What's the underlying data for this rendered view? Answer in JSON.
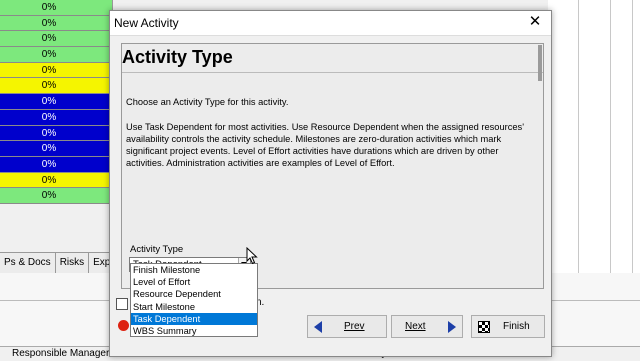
{
  "background": {
    "grid_rows": [
      {
        "text": "0%",
        "color": "green"
      },
      {
        "text": "0%",
        "color": "green"
      },
      {
        "text": "0%",
        "color": "green"
      },
      {
        "text": "0%",
        "color": "green"
      },
      {
        "text": "0%",
        "color": "yellow"
      },
      {
        "text": "0%",
        "color": "yellow"
      },
      {
        "text": "0%",
        "color": "blue"
      },
      {
        "text": "0%",
        "color": "blue"
      },
      {
        "text": "0%",
        "color": "blue"
      },
      {
        "text": "0%",
        "color": "blue"
      },
      {
        "text": "0%",
        "color": "blue"
      },
      {
        "text": "0%",
        "color": "yellow"
      },
      {
        "text": "0%",
        "color": "green"
      }
    ],
    "tabs": [
      "Ps & Docs",
      "Risks",
      "Expens"
    ],
    "footer": {
      "responsible_manager": "Responsible Manager",
      "primary_resource": "Primary Resource"
    },
    "colors": {
      "green": "#7de87d",
      "yellow": "#f5f500",
      "blue": "#0000cc"
    }
  },
  "dialog": {
    "title": "New Activity",
    "heading": "Activity Type",
    "intro": "Choose an Activity Type for this activity.",
    "description": "Use Task Dependent for most activities.  Use Resource Dependent when the assigned resources' availability controls the activity schedule. Milestones are zero-duration activities which mark significant project events.  Level of Effort activities have durations which are driven by other activities.  Administration activities are examples of Level of Effort.",
    "activity_type_label": "Activity Type",
    "activity_type_value": "Task Dependent",
    "activity_type_options": [
      "Finish Milestone",
      "Level of Effort",
      "Resource Dependent",
      "Start Milestone",
      "Task Dependent",
      "WBS Summary"
    ],
    "selected_option": "Task Dependent",
    "checkbox_tail": "n.",
    "buttons": {
      "prev": "Prev",
      "next": "Next",
      "finish": "Finish"
    },
    "accent_color": "#0078d7"
  }
}
